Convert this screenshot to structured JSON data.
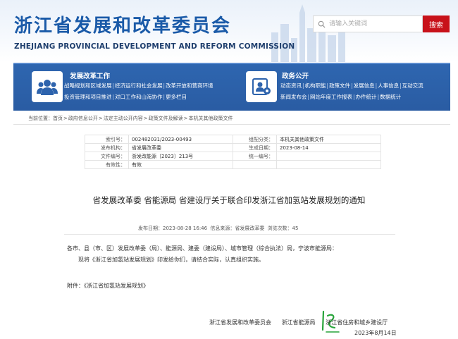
{
  "header": {
    "title": "浙江省发展和改革委员会",
    "subtitle": "ZHEJIANG PROVINCIAL DEVELOPMENT AND REFORM COMMISSION",
    "search_placeholder": "请输入关键词",
    "search_button": "搜索"
  },
  "nav": {
    "left": {
      "heading": "发展改革工作",
      "row1": [
        "战略规划和区域发展",
        "经济运行和社会发展",
        "改革开放和营商环境"
      ],
      "row2": [
        "投资管理和项目推进",
        "对口工作和山海协作",
        "更多栏目"
      ]
    },
    "right": {
      "heading": "政务公开",
      "row1": [
        "动态资讯",
        "机构职能",
        "政策文件",
        "发展信息",
        "人事信息",
        "互动交流"
      ],
      "row2": [
        "新闻发布会",
        "网站年度工作报表",
        "办件统计",
        "数据统计"
      ]
    }
  },
  "breadcrumb": {
    "label": "当前位置：",
    "items": [
      "首页",
      "政府信息公开",
      "法定主动公开内容",
      "政策文件及解读",
      "本机关其他政策文件"
    ]
  },
  "meta": {
    "rows": [
      {
        "k1": "索引号：",
        "v1": "002482031/2023-00493",
        "k2": "组配分类：",
        "v2": "本机关其他政策文件"
      },
      {
        "k1": "发布机构：",
        "v1": "省发展改革委",
        "k2": "生成日期：",
        "v2": "2023-08-14"
      },
      {
        "k1": "文件编号：",
        "v1": "浙发改能源〔2023〕213号",
        "k2": "统一编号：",
        "v2": ""
      },
      {
        "k1": "有效性：",
        "v1": "有效",
        "k2": "",
        "v2": ""
      }
    ]
  },
  "article": {
    "title": "省发展改革委 省能源局 省建设厅关于联合印发浙江省加氢站发展规划的通知",
    "publish_time": "发布日期：2023-08-28 16:46",
    "source": "信息来源：省发展改革委",
    "views": "浏览次数：45",
    "recipients": "各市、县（市、区）发展改革委（局）、能源局、建委（建设局）、城市管理（综合执法）局，宁波市能源局：",
    "body": "现将《浙江省加氢站发展规划》印发给你们，请结合实际，认真组织实施。",
    "attachment": "附件：《浙江省加氢站发展规划》",
    "signers": [
      "浙江省发展和改革委员会",
      "浙江省能源局",
      "浙江省住房和城乡建设厅"
    ],
    "date": "2023年8月14日"
  }
}
